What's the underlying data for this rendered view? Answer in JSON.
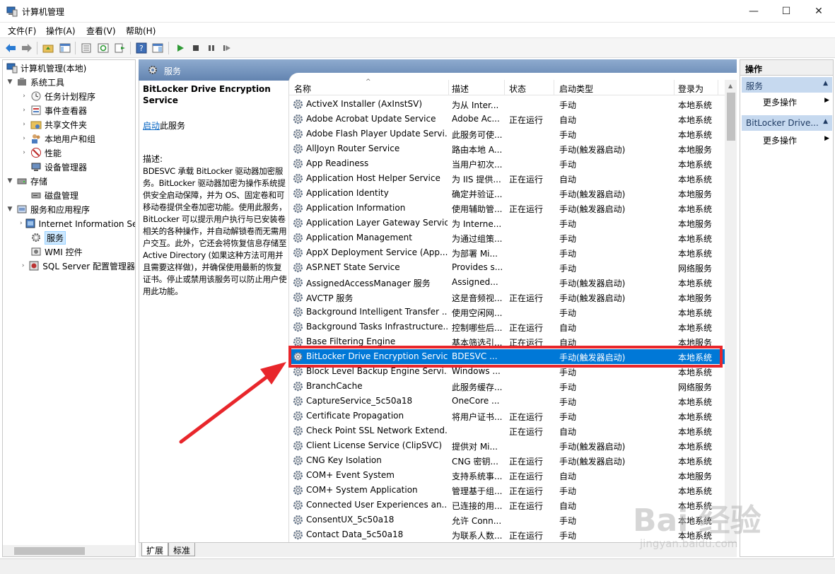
{
  "window": {
    "title": "计算机管理",
    "minimize": "—",
    "maximize": "☐",
    "close": "✕"
  },
  "menu": [
    "文件(F)",
    "操作(A)",
    "查看(V)",
    "帮助(H)"
  ],
  "tree": {
    "items": [
      {
        "label": "计算机管理(本地)",
        "icon": "computer-management-icon"
      },
      {
        "label": "系统工具",
        "icon": "tools-icon"
      },
      {
        "label": "任务计划程序",
        "icon": "clock-icon"
      },
      {
        "label": "事件查看器",
        "icon": "event-viewer-icon"
      },
      {
        "label": "共享文件夹",
        "icon": "shared-folder-icon"
      },
      {
        "label": "本地用户和组",
        "icon": "users-icon"
      },
      {
        "label": "性能",
        "icon": "performance-icon"
      },
      {
        "label": "设备管理器",
        "icon": "device-manager-icon"
      },
      {
        "label": "存储",
        "icon": "storage-icon"
      },
      {
        "label": "磁盘管理",
        "icon": "disk-icon"
      },
      {
        "label": "服务和应用程序",
        "icon": "services-apps-icon"
      },
      {
        "label": "Internet Information Services (IIS)管理器",
        "icon": "iis-icon"
      },
      {
        "label": "服务",
        "icon": "services-icon"
      },
      {
        "label": "WMI 控件",
        "icon": "wmi-icon"
      },
      {
        "label": "SQL Server 配置管理器",
        "icon": "sql-icon"
      }
    ]
  },
  "center": {
    "header": "服务",
    "detail": {
      "title": "BitLocker Drive Encryption Service",
      "start_link": "启动",
      "start_suffix": "此服务",
      "desc_label": "描述:",
      "desc_text": "BDESVC 承载 BitLocker 驱动器加密服务。BitLocker 驱动器加密为操作系统提供安全启动保障，并为 OS、固定卷和可移动卷提供全卷加密功能。使用此服务，BitLocker 可以提示用户执行与已安装卷相关的各种操作，并自动解锁卷而无需用户交互。此外，它还会将恢复信息存储至 Active Directory (如果这种方法可用并且需要这样做)，并确保使用最新的恢复证书。停止或禁用该服务可以防止用户使用此功能。"
    },
    "columns": [
      "名称",
      "描述",
      "状态",
      "启动类型",
      "登录为"
    ],
    "rows": [
      {
        "name": "ActiveX Installer (AxInstSV)",
        "desc": "为从 Inter...",
        "status": "",
        "startup": "手动",
        "logon": "本地系统"
      },
      {
        "name": "Adobe Acrobat Update Service",
        "desc": "Adobe Ac...",
        "status": "正在运行",
        "startup": "自动",
        "logon": "本地系统"
      },
      {
        "name": "Adobe Flash Player Update Servi...",
        "desc": "此服务可使...",
        "status": "",
        "startup": "手动",
        "logon": "本地系统"
      },
      {
        "name": "AllJoyn Router Service",
        "desc": "路由本地 A...",
        "status": "",
        "startup": "手动(触发器启动)",
        "logon": "本地服务"
      },
      {
        "name": "App Readiness",
        "desc": "当用户初次...",
        "status": "",
        "startup": "手动",
        "logon": "本地系统"
      },
      {
        "name": "Application Host Helper Service",
        "desc": "为 IIS 提供...",
        "status": "正在运行",
        "startup": "自动",
        "logon": "本地系统"
      },
      {
        "name": "Application Identity",
        "desc": "确定并验证...",
        "status": "",
        "startup": "手动(触发器启动)",
        "logon": "本地服务"
      },
      {
        "name": "Application Information",
        "desc": "使用辅助管...",
        "status": "正在运行",
        "startup": "手动(触发器启动)",
        "logon": "本地系统"
      },
      {
        "name": "Application Layer Gateway Service",
        "desc": "为 Interne...",
        "status": "",
        "startup": "手动",
        "logon": "本地服务"
      },
      {
        "name": "Application Management",
        "desc": "为通过组策...",
        "status": "",
        "startup": "手动",
        "logon": "本地系统"
      },
      {
        "name": "AppX Deployment Service (App...",
        "desc": "为部署 Mi...",
        "status": "",
        "startup": "手动",
        "logon": "本地系统"
      },
      {
        "name": "ASP.NET State Service",
        "desc": "Provides s...",
        "status": "",
        "startup": "手动",
        "logon": "网络服务"
      },
      {
        "name": "AssignedAccessManager 服务",
        "desc": "Assigned...",
        "status": "",
        "startup": "手动(触发器启动)",
        "logon": "本地系统"
      },
      {
        "name": "AVCTP 服务",
        "desc": "这是音频视...",
        "status": "正在运行",
        "startup": "手动(触发器启动)",
        "logon": "本地服务"
      },
      {
        "name": "Background Intelligent Transfer ...",
        "desc": "使用空闲网...",
        "status": "",
        "startup": "手动",
        "logon": "本地系统"
      },
      {
        "name": "Background Tasks Infrastructure...",
        "desc": "控制哪些后...",
        "status": "正在运行",
        "startup": "自动",
        "logon": "本地系统"
      },
      {
        "name": "Base Filtering Engine",
        "desc": "基本筛选引...",
        "status": "正在运行",
        "startup": "自动",
        "logon": "本地服务"
      },
      {
        "name": "BitLocker Drive Encryption Service",
        "desc": "BDESVC ...",
        "status": "",
        "startup": "手动(触发器启动)",
        "logon": "本地系统"
      },
      {
        "name": "Block Level Backup Engine Servi...",
        "desc": "Windows ...",
        "status": "",
        "startup": "手动",
        "logon": "本地系统"
      },
      {
        "name": "BranchCache",
        "desc": "此服务缓存...",
        "status": "",
        "startup": "手动",
        "logon": "网络服务"
      },
      {
        "name": "CaptureService_5c50a18",
        "desc": "OneCore ...",
        "status": "",
        "startup": "手动",
        "logon": "本地系统"
      },
      {
        "name": "Certificate Propagation",
        "desc": "将用户证书...",
        "status": "正在运行",
        "startup": "手动",
        "logon": "本地系统"
      },
      {
        "name": "Check Point SSL Network Extend...",
        "desc": "",
        "status": "正在运行",
        "startup": "自动",
        "logon": "本地系统"
      },
      {
        "name": "Client License Service (ClipSVC)",
        "desc": "提供对 Mi...",
        "status": "",
        "startup": "手动(触发器启动)",
        "logon": "本地系统"
      },
      {
        "name": "CNG Key Isolation",
        "desc": "CNG 密钥...",
        "status": "正在运行",
        "startup": "手动(触发器启动)",
        "logon": "本地系统"
      },
      {
        "name": "COM+ Event System",
        "desc": "支持系统事...",
        "status": "正在运行",
        "startup": "自动",
        "logon": "本地服务"
      },
      {
        "name": "COM+ System Application",
        "desc": "管理基于组...",
        "status": "正在运行",
        "startup": "手动",
        "logon": "本地系统"
      },
      {
        "name": "Connected User Experiences an...",
        "desc": "已连接的用...",
        "status": "正在运行",
        "startup": "自动",
        "logon": "本地系统"
      },
      {
        "name": "ConsentUX_5c50a18",
        "desc": "允许 Conn...",
        "status": "",
        "startup": "手动",
        "logon": "本地系统"
      },
      {
        "name": "Contact Data_5c50a18",
        "desc": "为联系人数...",
        "status": "正在运行",
        "startup": "手动",
        "logon": "本地系统"
      }
    ],
    "tabs": [
      "扩展",
      "标准"
    ]
  },
  "actions": {
    "title": "操作",
    "groups": [
      {
        "label": "服务",
        "more": "更多操作"
      },
      {
        "label": "BitLocker Drive...",
        "more": "更多操作"
      }
    ]
  },
  "watermark": {
    "main": "Bai 经验",
    "sub": "jingyan.baidu.com"
  },
  "colors": {
    "selection": "#0078d7",
    "highlight_box": "#e8262b",
    "header_blue": "#6384b0"
  }
}
